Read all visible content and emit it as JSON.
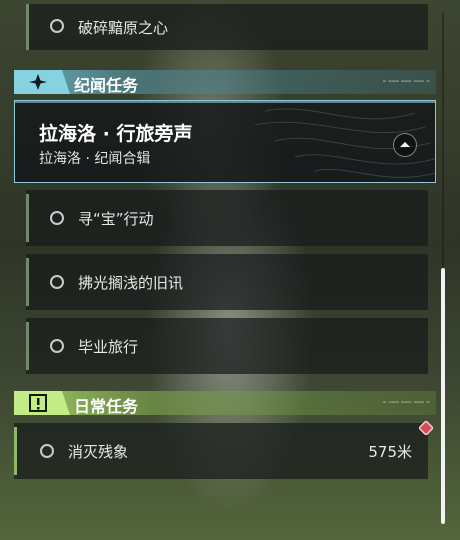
{
  "quests_top": {
    "item": "破碎黯原之心"
  },
  "section_story": {
    "title": "纪闻任务",
    "badge_icon": "sparkle-icon",
    "color": "#7fc9d8"
  },
  "featured": {
    "title": "拉海洛 · 行旅旁声",
    "subtitle": "拉海洛 · 纪闻合辑",
    "toggle_icon": "collapse-arrow-icon"
  },
  "story_items": [
    {
      "label": "寻“宝”行动"
    },
    {
      "label": "拂光搁浅的旧讯"
    },
    {
      "label": "毕业旅行"
    }
  ],
  "section_daily": {
    "title": "日常任务",
    "badge_icon": "exclamation-box-icon",
    "color": "#b7e07a"
  },
  "daily_items": [
    {
      "label": "消灭残象",
      "distance": "575米",
      "marker_icon": "diamond-marker-icon",
      "marker_color": "#e0545e"
    }
  ],
  "scroll": {
    "position_fraction": 0.5
  }
}
